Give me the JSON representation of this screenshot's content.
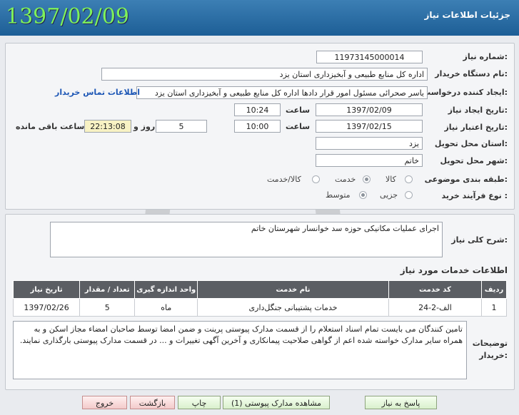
{
  "header": {
    "title": "جزئیات اطلاعات نیاز",
    "date_stamp": "1397/02/09"
  },
  "form": {
    "need_number_label": "شماره نیاز:",
    "need_number": "11973145000014",
    "buyer_org_label": "نام دستگاه خریدار:",
    "buyer_org": "اداره کل منابع طبیعی و آبخیزداری استان یزد",
    "requester_label": "ایجاد کننده درخواست:",
    "requester": "یاسر صحرائی مسئول امور قرار دادها  اداره کل منابع طبیعی و آبخیزداری استان یزد",
    "buyer_contact_link": "اطلاعات تماس خریدار",
    "created_label": "تاریخ ایجاد نیاز:",
    "created_date": "1397/02/09",
    "time_label": "ساعت",
    "created_time": "10:24",
    "validity_label": "تاریخ اعتبار نیاز:",
    "validity_date": "1397/02/15",
    "validity_time": "10:00",
    "days_value": "5",
    "days_word": "روز و",
    "remaining_time": "22:13:08",
    "remaining_label": "ساعت باقی مانده",
    "province_label": "استان محل تحویل:",
    "province": "یزد",
    "city_label": "شهر محل تحویل:",
    "city": "خاتم",
    "category_label": "طبقه بندی موضوعی:",
    "category_options": [
      "کالا",
      "خدمت",
      "کالا/خدمت"
    ],
    "category_selected": "خدمت",
    "process_label": "نوع فرآیند خرید :",
    "process_options": [
      "جزیی",
      "متوسط"
    ],
    "process_selected": "متوسط"
  },
  "summary": {
    "label": "شرح کلی نیاز:",
    "text": "اجرای عملیات مکانیکی حوزه سد خوانسار شهرستان خاتم"
  },
  "services": {
    "heading": "اطلاعات خدمات مورد نیاز",
    "columns": [
      "ردیف",
      "کد خدمت",
      "نام خدمت",
      "واحد اندازه گیری",
      "تعداد / مقدار",
      "تاریخ نیاز"
    ],
    "rows": [
      {
        "row": "1",
        "code": "الف-2-24",
        "name": "خدمات پشتیبانی جنگل‌داری",
        "unit": "ماه",
        "qty": "5",
        "date": "1397/02/26"
      }
    ]
  },
  "notes": {
    "label_line1": "توضیحات",
    "label_line2": "خریدار:",
    "text": "تامین کنندگان می بایست تمام اسناد استعلام را از قسمت مدارک پیوستی پرینت و ضمن امضا توسط صاحبان امضاء مجاز اسکن و به همراه سایر مدارک خواسته شده اعم از گواهی صلاحیت پیمانکاری و آخرین آگهی تغییرات و ... در قسمت مدارک پیوستی بارگذاری نمایند."
  },
  "buttons": {
    "reply": "پاسخ به نیاز",
    "attachments": "مشاهده مدارک پیوستی (1)",
    "print": "چاپ",
    "back": "بازگشت",
    "exit": "خروج"
  },
  "colors": {
    "header_bg": "#1d5e96",
    "date_stamp": "#7ef25a",
    "table_header": "#5b5e63",
    "link": "#1c56b5"
  }
}
